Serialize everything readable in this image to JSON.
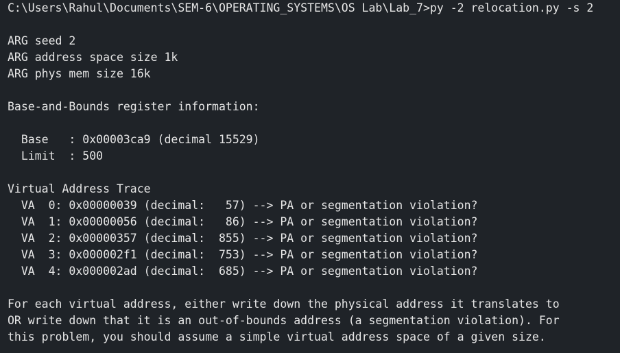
{
  "command_line": "C:\\Users\\Rahul\\Documents\\SEM-6\\OPERATING_SYSTEMS\\OS Lab\\Lab_7>py -2 relocation.py -s 2",
  "args": [
    "ARG seed 2",
    "ARG address space size 1k",
    "ARG phys mem size 16k"
  ],
  "register_heading": "Base-and-Bounds register information:",
  "registers": [
    "  Base   : 0x00003ca9 (decimal 15529)",
    "  Limit  : 500"
  ],
  "trace_heading": "Virtual Address Trace",
  "trace": [
    "  VA  0: 0x00000039 (decimal:   57) --> PA or segmentation violation?",
    "  VA  1: 0x00000056 (decimal:   86) --> PA or segmentation violation?",
    "  VA  2: 0x00000357 (decimal:  855) --> PA or segmentation violation?",
    "  VA  3: 0x000002f1 (decimal:  753) --> PA or segmentation violation?",
    "  VA  4: 0x000002ad (decimal:  685) --> PA or segmentation violation?"
  ],
  "instructions": [
    "For each virtual address, either write down the physical address it translates to",
    "OR write down that it is an out-of-bounds address (a segmentation violation). For",
    "this problem, you should assume a simple virtual address space of a given size."
  ],
  "colors": {
    "background": "#1f2328",
    "text": "#e6e6e6"
  }
}
